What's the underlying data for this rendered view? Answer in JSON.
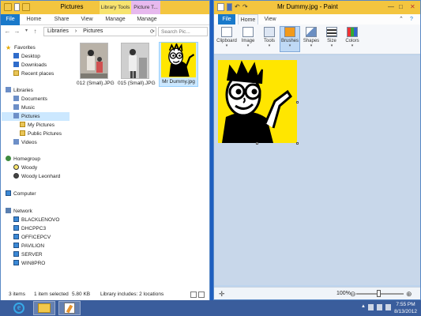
{
  "explorer": {
    "title": "Pictures",
    "context_tabs": {
      "library_tools": "Library Tools",
      "picture_tools": "Picture T..."
    },
    "tabs": [
      "File",
      "Home",
      "Share",
      "View",
      "Manage",
      "Manage"
    ],
    "address": {
      "root": "Libraries",
      "current": "Pictures"
    },
    "search_placeholder": "Search Pic...",
    "nav": [
      {
        "label": "Favorites",
        "icon": "star-icon"
      },
      {
        "label": "Desktop",
        "icon": "desktop-icon"
      },
      {
        "label": "Downloads",
        "icon": "downloads-icon"
      },
      {
        "label": "Recent places",
        "icon": "recent-places-icon"
      },
      {
        "label": "Libraries",
        "icon": "libraries-icon"
      },
      {
        "label": "Documents",
        "icon": "documents-icon"
      },
      {
        "label": "Music",
        "icon": "music-icon"
      },
      {
        "label": "Pictures",
        "icon": "pictures-icon"
      },
      {
        "label": "My Pictures",
        "icon": "folder-icon"
      },
      {
        "label": "Public Pictures",
        "icon": "folder-icon"
      },
      {
        "label": "Videos",
        "icon": "videos-icon"
      },
      {
        "label": "Homegroup",
        "icon": "homegroup-icon"
      },
      {
        "label": "Woody",
        "icon": "user-icon"
      },
      {
        "label": "Woody Leonhard",
        "icon": "user-icon"
      },
      {
        "label": "Computer",
        "icon": "computer-icon"
      },
      {
        "label": "Network",
        "icon": "network-icon"
      },
      {
        "label": "BLACKLENOVO",
        "icon": "computer-icon"
      },
      {
        "label": "DHCPPC3",
        "icon": "computer-icon"
      },
      {
        "label": "OFFICEPCV",
        "icon": "computer-icon"
      },
      {
        "label": "PAVILION",
        "icon": "computer-icon"
      },
      {
        "label": "SERVER",
        "icon": "computer-icon"
      },
      {
        "label": "WIN8PRO",
        "icon": "computer-icon"
      }
    ],
    "files": [
      {
        "name": "012 (Small).JPG"
      },
      {
        "name": "015 (Small).JPG"
      },
      {
        "name": "Mr Dummy.jpg"
      }
    ],
    "status": {
      "items": "3 items",
      "selected": "1 item selected",
      "size": "5.80 KB",
      "library": "Library includes: 2 locations"
    }
  },
  "paint": {
    "title": "Mr Dummy.jpg - Paint",
    "tabs": [
      "File",
      "Home",
      "View"
    ],
    "ribbon": [
      "Clipboard",
      "Image",
      "Tools",
      "Brushes",
      "Shapes",
      "Size",
      "Colors"
    ],
    "zoom": "100%"
  },
  "taskbar": {
    "time": "7:55 PM",
    "date": "8/13/2012"
  },
  "colors": {
    "title_accent": "#f3c53f",
    "file_tab": "#1979ca",
    "taskbar": "#3a5d9c",
    "canvas_bg": "#ffe600"
  }
}
